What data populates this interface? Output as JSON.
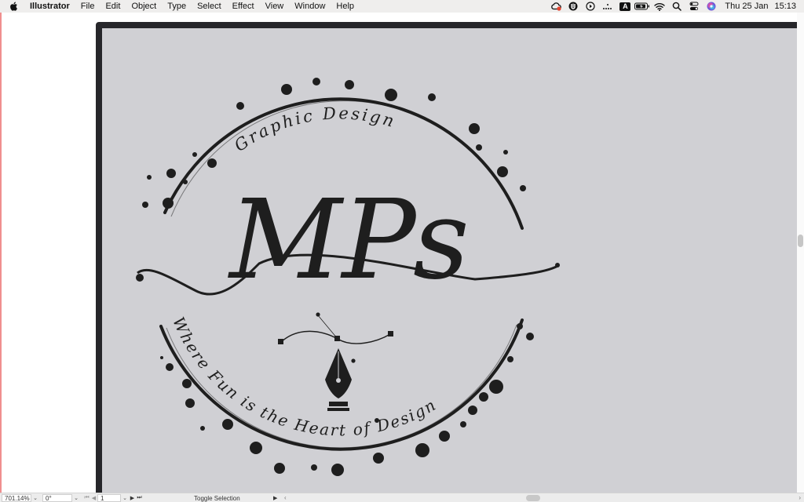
{
  "menubar": {
    "app_name": "Illustrator",
    "items": [
      "File",
      "Edit",
      "Object",
      "Type",
      "Select",
      "Effect",
      "View",
      "Window",
      "Help"
    ],
    "status_icons": [
      "creative-cloud-icon",
      "torrent-icon",
      "play-icon",
      "dots-icon",
      "input-source-icon",
      "battery-icon",
      "wifi-icon",
      "search-icon",
      "control-center-icon",
      "siri-icon"
    ],
    "input_source": "A",
    "date": "Thu 25 Jan",
    "time": "15:13"
  },
  "artwork": {
    "top_text": "Graphic Design",
    "monogram": "MPs",
    "bottom_text": "Where Fun is the Heart of Design",
    "ink_color": "#1e1e1e",
    "canvas_color": "#d0d0d4"
  },
  "statusbar": {
    "zoom": "701.14%",
    "rotation": "0°",
    "artboard": "1",
    "tool_status": "Toggle Selection"
  }
}
